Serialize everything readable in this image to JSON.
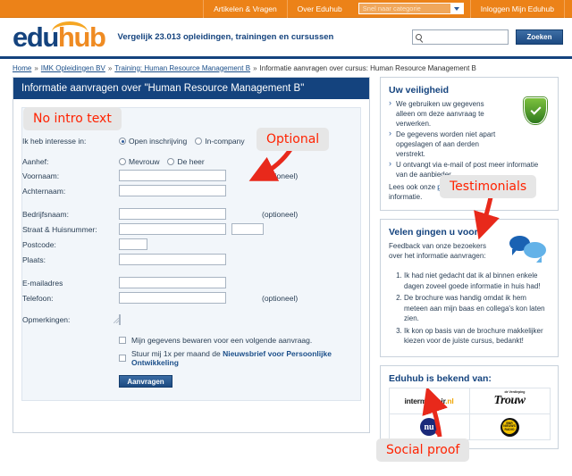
{
  "topbar": {
    "links": [
      "Artikelen & Vragen",
      "Over Eduhub"
    ],
    "select_placeholder": "Snel naar categorie",
    "login_label": "Inloggen Mijn Eduhub"
  },
  "header": {
    "logo_edu": "edu",
    "logo_hub": "hub",
    "tagline": "Vergelijk 23.013 opleidingen, trainingen en cursussen",
    "search_value": "",
    "search_button": "Zoeken"
  },
  "breadcrumb": {
    "items": [
      "Home",
      "IMK Opleidingen BV",
      "Training: Human Resource Management B",
      "Informatie aanvragen over cursus: Human Resource Management B"
    ],
    "separator": "»"
  },
  "form": {
    "title": "Informatie aanvragen over \"Human Resource Management B\"",
    "interest_label": "Ik heb interesse in:",
    "interest_options": [
      "Open inschrijving",
      "In-company"
    ],
    "interest_selected": "Open inschrijving",
    "salutation_label": "Aanhef:",
    "salutation_options": [
      "Mevrouw",
      "De heer"
    ],
    "salutation_selected": "",
    "fields": [
      {
        "label": "Voornaam:",
        "value": "",
        "optional": "(optioneel)"
      },
      {
        "label": "Achternaam:",
        "value": "",
        "optional": ""
      },
      {
        "label": "Bedrijfsnaam:",
        "value": "",
        "optional": "(optioneel)"
      },
      {
        "label": "Straat & Huisnummer:",
        "value": "",
        "value2": "",
        "optional": ""
      },
      {
        "label": "Postcode:",
        "value": "",
        "optional": ""
      },
      {
        "label": "Plaats:",
        "value": "",
        "optional": ""
      },
      {
        "label": "E-mailadres",
        "value": "",
        "optional": ""
      },
      {
        "label": "Telefoon:",
        "value": "",
        "optional": "(optioneel)"
      }
    ],
    "remarks_label": "Opmerkingen:",
    "remarks_value": "",
    "checkbox_save": "Mijn gegevens bewaren voor een volgende aanvraag.",
    "checkbox_news_prefix": "Stuur mij 1x per maand de ",
    "checkbox_news_bold": "Nieuwsbrief voor Persoonlijke Ontwikkeling",
    "submit_label": "Aanvragen"
  },
  "sidebar": {
    "security": {
      "title": "Uw veiligheid",
      "bullets": [
        "We gebruiken uw gegevens alleen om deze aanvraag te verwerken.",
        "De gegevens worden niet apart opgeslagen of aan derden verstrekt.",
        "U ontvangt via e-mail of post meer informatie van de aanbieder."
      ],
      "footer_prefix": "Lees ook onze ",
      "footer_link": "privacyverklaring",
      "footer_suffix": " voor meer informatie."
    },
    "testimonials": {
      "title": "Velen gingen u voor",
      "subtitle": "Feedback van onze bezoekers over het informatie aanvragen:",
      "items": [
        "Ik had niet gedacht dat ik al binnen enkele dagen zoveel goede informatie in huis had!",
        "De brochure was handig omdat ik hem meteen aan mijn baas en collega's kon laten zien.",
        "Ik kon op basis van de brochure makkelijker kiezen voor de juiste cursus, bedankt!"
      ]
    },
    "press": {
      "title": "Eduhub is bekend van:",
      "logos": [
        {
          "name": "intermediair.nl",
          "main": "intermediair",
          "accent": ".nl"
        },
        {
          "name": "Trouw",
          "main": "Trouw",
          "sup": "de Verdieping"
        },
        {
          "name": "nu.nl",
          "main": "nu"
        },
        {
          "name": "BNR Nieuwsradio",
          "main": "BNR NIEUWS RADIO"
        }
      ]
    }
  },
  "annotations": [
    {
      "id": "no-intro-text",
      "text": "No intro text"
    },
    {
      "id": "optional",
      "text": "Optional"
    },
    {
      "id": "testimonials",
      "text": "Testimonials"
    },
    {
      "id": "social-proof",
      "text": "Social proof"
    }
  ],
  "colors": {
    "orange": "#ec8218",
    "navy": "#14437e",
    "annotation_red": "#ff2200",
    "annotation_bg": "#e6e6e6"
  }
}
